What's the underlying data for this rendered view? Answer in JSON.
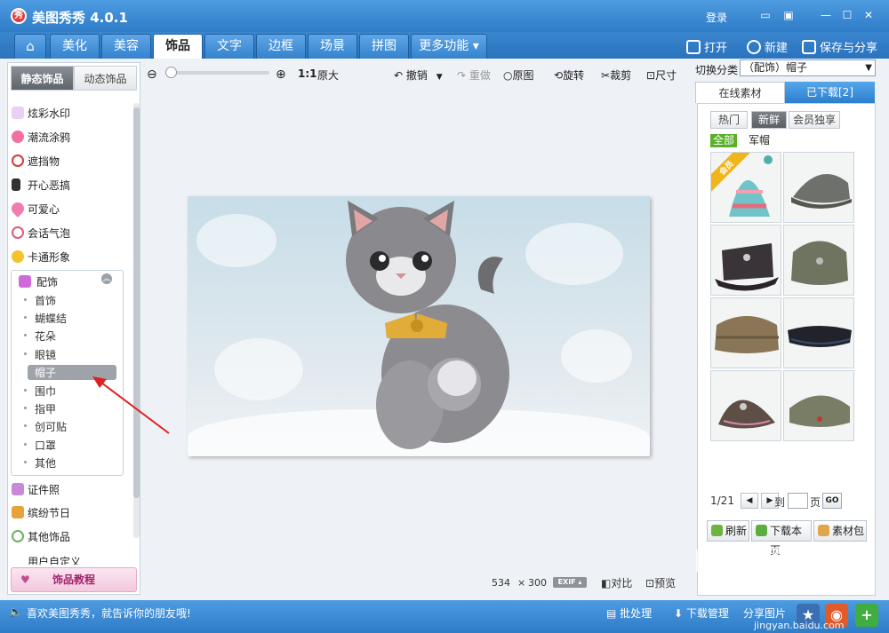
{
  "app": {
    "title": "美图秀秀 4.0.1",
    "logo_char": "秀",
    "login": "登录"
  },
  "main_tabs": [
    {
      "label": "美化"
    },
    {
      "label": "美容"
    },
    {
      "label": "饰品"
    },
    {
      "label": "文字"
    },
    {
      "label": "边框"
    },
    {
      "label": "场景"
    },
    {
      "label": "拼图"
    },
    {
      "label": "更多功能 ▾"
    }
  ],
  "top_actions": {
    "open": "打开",
    "new": "新建",
    "save": "保存与分享"
  },
  "left_panel": {
    "tabs": [
      "静态饰品",
      "动态饰品"
    ],
    "categories_top": [
      "炫彩水印",
      "潮流涂鸦",
      "遮挡物",
      "开心恶搞",
      "可爱心",
      "会话气泡",
      "卡通形象"
    ],
    "group_title": "配饰",
    "group_items": [
      "首饰",
      "蝴蝶结",
      "花朵",
      "眼镜",
      "帽子",
      "围巾",
      "指甲",
      "创可贴",
      "口罩",
      "其他"
    ],
    "selected_item": "帽子",
    "categories_bottom": [
      "证件照",
      "缤纷节日",
      "其他饰品",
      "用户自定义"
    ],
    "tutorial": "饰品教程"
  },
  "canvas_toolbar": {
    "ratio": "1:1",
    "original_size": "原大",
    "undo": "撤销",
    "redo": "重做",
    "original": "原图",
    "rotate": "旋转",
    "crop": "裁剪",
    "size": "尺寸"
  },
  "canvas_status": {
    "width": "534",
    "times": "×",
    "height": "300",
    "exif": "EXIF ▴",
    "compare": "对比",
    "preview": "预览"
  },
  "right_panel": {
    "category_label": "切换分类",
    "category_value": "（配饰）帽子",
    "tabs": [
      "在线素材",
      "已下载[2]"
    ],
    "pills": [
      "热门",
      "新鲜",
      "会员独享"
    ],
    "filters": [
      "全部",
      "军帽"
    ],
    "member_badge": "会员",
    "page": "1/21",
    "to": "到",
    "page_unit": "页",
    "go": "GO",
    "actions": [
      "刷新",
      "下载本页",
      "素材包"
    ]
  },
  "bottom_bar": {
    "tip": "喜欢美图秀秀，就告诉你的朋友哦!",
    "batch": "批处理",
    "download_manage": "下载管理",
    "share": "分享图片"
  },
  "watermark": {
    "main": "Bai 经验",
    "url": "jingyan.baidu.com"
  },
  "colors": {
    "accent": "#2f7cc8",
    "arrow": "#e02020",
    "member_badge": "#f1b51c"
  }
}
